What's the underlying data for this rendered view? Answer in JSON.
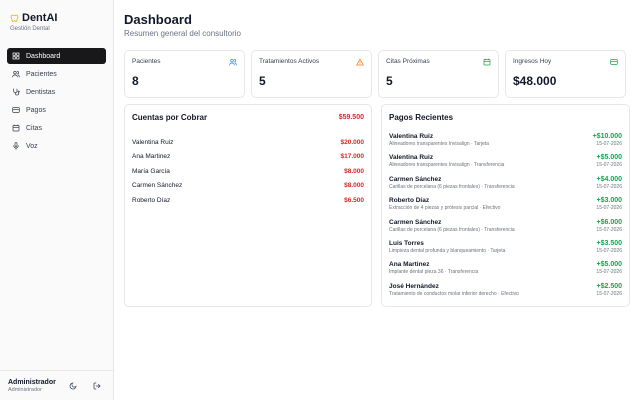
{
  "brand": {
    "name": "DentAI",
    "subtitle": "Gestión Dental"
  },
  "nav": [
    {
      "label": "Dashboard",
      "icon": "dashboard-icon",
      "active": true
    },
    {
      "label": "Pacientes",
      "icon": "users-icon",
      "active": false
    },
    {
      "label": "Dentistas",
      "icon": "stethoscope-icon",
      "active": false
    },
    {
      "label": "Pagos",
      "icon": "credit-card-icon",
      "active": false
    },
    {
      "label": "Citas",
      "icon": "calendar-icon",
      "active": false
    },
    {
      "label": "Voz",
      "icon": "microphone-icon",
      "active": false
    }
  ],
  "user": {
    "name": "Administrador",
    "role": "Administrador"
  },
  "header": {
    "title": "Dashboard",
    "subtitle": "Resumen general del consultorio"
  },
  "stats": [
    {
      "label": "Pacientes",
      "value": "8",
      "icon": "users-icon",
      "color": "#3b82f6"
    },
    {
      "label": "Tratamientos Activos",
      "value": "5",
      "icon": "warning-icon",
      "color": "#f97316"
    },
    {
      "label": "Citas Próximas",
      "value": "5",
      "icon": "calendar-icon",
      "color": "#16a34a"
    },
    {
      "label": "Ingresos Hoy",
      "value": "$48.000",
      "icon": "card-icon",
      "color": "#16a34a"
    }
  ],
  "receivables": {
    "title": "Cuentas por Cobrar",
    "total": "$59.500",
    "rows": [
      {
        "name": "Valentina Ruiz",
        "amount": "$20.000"
      },
      {
        "name": "Ana Martinez",
        "amount": "$17.000"
      },
      {
        "name": "María García",
        "amount": "$8.000"
      },
      {
        "name": "Carmen Sánchez",
        "amount": "$8.000"
      },
      {
        "name": "Roberto Díaz",
        "amount": "$6.500"
      }
    ]
  },
  "payments": {
    "title": "Pagos Recientes",
    "rows": [
      {
        "name": "Valentina Ruiz",
        "desc": "Alineadores transparentes Invisalign · Tarjeta",
        "amount": "+$10.000",
        "date": "15-07-2026"
      },
      {
        "name": "Valentina Ruiz",
        "desc": "Alineadores transparentes Invisalign · Transferencia",
        "amount": "+$5.000",
        "date": "15-07-2026"
      },
      {
        "name": "Carmen Sánchez",
        "desc": "Carillas de porcelana (6 piezas frontales) · Transferencia",
        "amount": "+$4.000",
        "date": "15-07-2026"
      },
      {
        "name": "Roberto Díaz",
        "desc": "Extracción de 4 piezas y prótesis parcial · Efectivo",
        "amount": "+$3.000",
        "date": "15-07-2026"
      },
      {
        "name": "Carmen Sánchez",
        "desc": "Carillas de porcelana (6 piezas frontales) · Transferencia",
        "amount": "+$6.000",
        "date": "15-07-2026"
      },
      {
        "name": "Luis Torres",
        "desc": "Limpieza dental profunda y blanqueamiento · Tarjeta",
        "amount": "+$3.500",
        "date": "15-07-2026"
      },
      {
        "name": "Ana Martinez",
        "desc": "Implante dental pieza 36 · Transferencia",
        "amount": "+$5.000",
        "date": "15-07-2026"
      },
      {
        "name": "José Hernández",
        "desc": "Tratamiento de conductos molar inferior derecho · Efectivo",
        "amount": "+$2.500",
        "date": "15-07-2026"
      }
    ]
  }
}
